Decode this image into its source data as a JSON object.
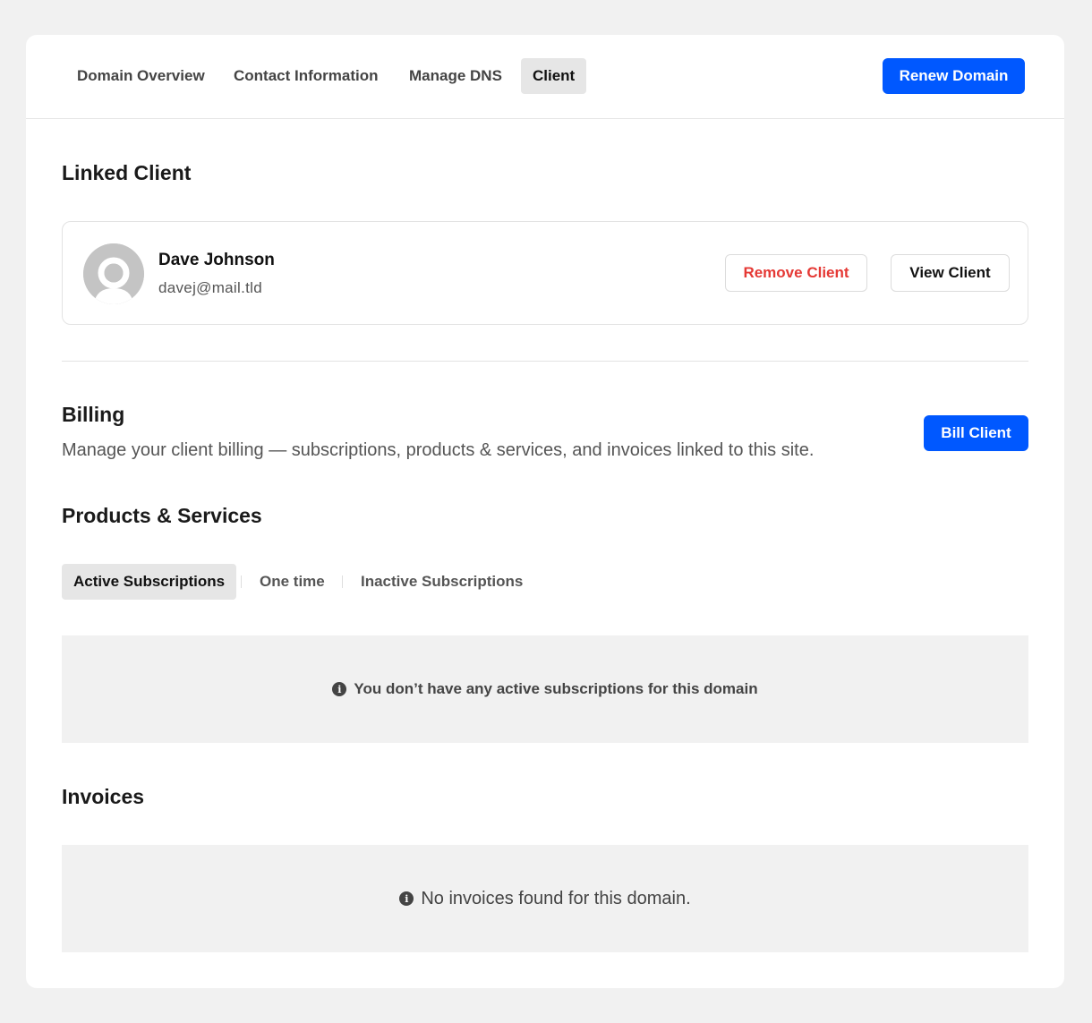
{
  "nav": {
    "tabs": [
      {
        "label": "Domain Overview"
      },
      {
        "label": "Contact Information"
      },
      {
        "label": "Manage DNS"
      },
      {
        "label": "Client"
      }
    ],
    "renew_label": "Renew Domain"
  },
  "linked_client": {
    "heading": "Linked Client",
    "name": "Dave Johnson",
    "email": "davej@mail.tld",
    "remove_label": "Remove Client",
    "view_label": "View Client"
  },
  "billing": {
    "heading": "Billing",
    "description": "Manage your client billing — subscriptions, products & services, and invoices linked to this site.",
    "bill_label": "Bill Client"
  },
  "products": {
    "heading": "Products & Services",
    "tabs": [
      {
        "label": "Active Subscriptions"
      },
      {
        "label": "One time"
      },
      {
        "label": "Inactive Subscriptions"
      }
    ],
    "empty_message": "You don’t have any active subscriptions for this domain"
  },
  "invoices": {
    "heading": "Invoices",
    "empty_message": "No invoices found for this domain."
  },
  "colors": {
    "accent": "#0058ff",
    "danger": "#e53935",
    "page_bg": "#f1f1f1"
  }
}
